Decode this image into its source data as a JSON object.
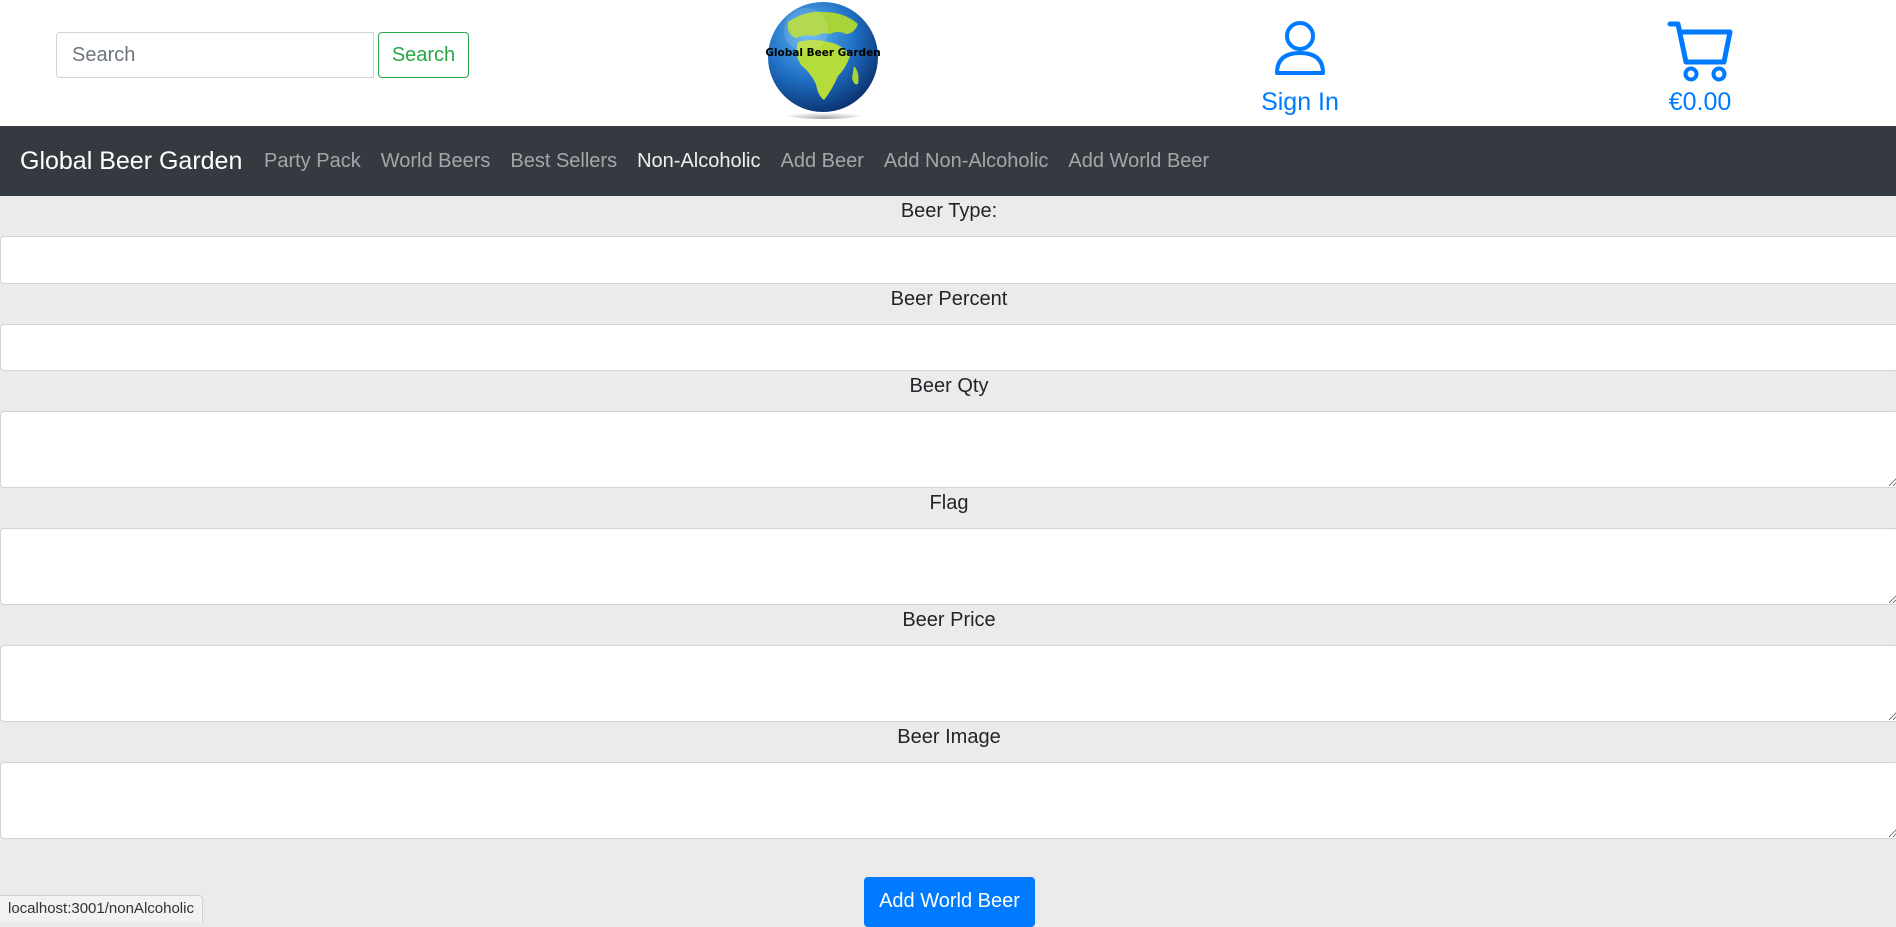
{
  "header": {
    "search": {
      "placeholder": "Search",
      "value": "",
      "button_label": "Search"
    },
    "logo_text": "Global Beer Garden",
    "sign_in_label": "Sign In",
    "cart_total": "€0.00"
  },
  "navbar": {
    "brand": "Global Beer Garden",
    "links": [
      {
        "label": "Party Pack"
      },
      {
        "label": "World Beers"
      },
      {
        "label": "Best Sellers"
      },
      {
        "label": "Non-Alcoholic",
        "active": true
      },
      {
        "label": "Add Beer"
      },
      {
        "label": "Add Non-Alcoholic"
      },
      {
        "label": "Add World Beer"
      }
    ]
  },
  "form": {
    "fields": [
      {
        "label": "Beer Type:",
        "value": ""
      },
      {
        "label": "Beer Percent",
        "value": ""
      },
      {
        "label": "Beer Qty",
        "value": ""
      },
      {
        "label": "Flag",
        "value": ""
      },
      {
        "label": "Beer Price",
        "value": ""
      },
      {
        "label": "Beer Image",
        "value": ""
      }
    ],
    "submit_label": "Add World Beer"
  },
  "status_bar": {
    "url": "localhost:3001/nonAlcoholic"
  },
  "colors": {
    "primary": "#007bff",
    "success": "#28a745",
    "navbar_bg": "#343a40",
    "page_bg": "#ebebeb"
  },
  "icons": {
    "sign_in": "user-icon",
    "cart": "shopping-cart-icon",
    "logo": "globe-logo-icon"
  }
}
